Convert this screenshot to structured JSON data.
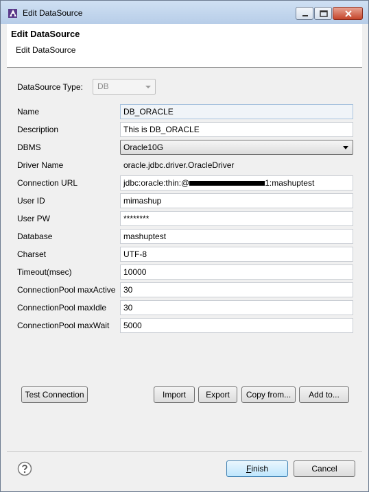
{
  "window": {
    "title": "Edit DataSource"
  },
  "header": {
    "title": "Edit DataSource",
    "subtitle": "Edit DataSource"
  },
  "datasource_type": {
    "label": "DataSource Type:",
    "value": "DB"
  },
  "fields": {
    "name": {
      "label": "Name",
      "value": "DB_ORACLE"
    },
    "description": {
      "label": "Description",
      "value": "This is DB_ORACLE"
    },
    "dbms": {
      "label": "DBMS",
      "value": "Oracle10G"
    },
    "driver_name": {
      "label": "Driver Name",
      "value": "oracle.jdbc.driver.OracleDriver"
    },
    "connection_url": {
      "label": "Connection URL",
      "prefix": "jdbc:oracle:thin:@",
      "suffix": "1:mashuptest"
    },
    "user_id": {
      "label": "User ID",
      "value": "mimashup"
    },
    "user_pw": {
      "label": "User PW",
      "value": "********"
    },
    "database": {
      "label": "Database",
      "value": "mashuptest"
    },
    "charset": {
      "label": "Charset",
      "value": "UTF-8"
    },
    "timeout": {
      "label": "Timeout(msec)",
      "value": "10000"
    },
    "pool_max_active": {
      "label": "ConnectionPool maxActive",
      "value": "30"
    },
    "pool_max_idle": {
      "label": "ConnectionPool maxIdle",
      "value": "30"
    },
    "pool_max_wait": {
      "label": "ConnectionPool maxWait",
      "value": "5000"
    }
  },
  "buttons": {
    "test_connection": "Test Connection",
    "import": "Import",
    "export": "Export",
    "copy_from": "Copy from...",
    "add_to": "Add to...",
    "finish_mnemonic": "F",
    "finish_rest": "inish",
    "cancel": "Cancel"
  },
  "icons": {
    "app": "eclipse-app-icon",
    "help": "help-icon",
    "minimize": "minimize-icon",
    "maximize": "maximize-icon",
    "close": "close-icon"
  }
}
